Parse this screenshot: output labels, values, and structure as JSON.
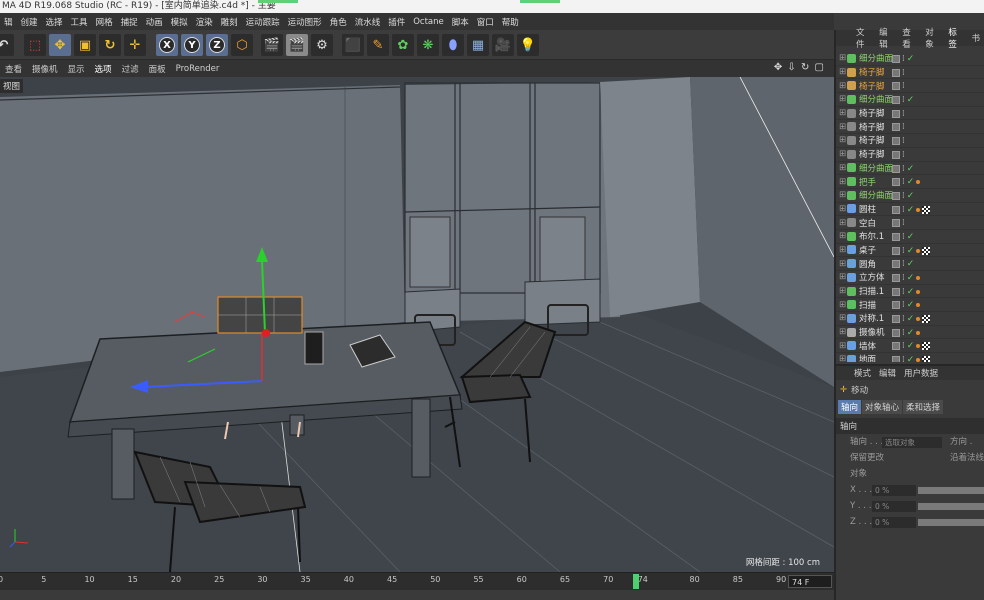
{
  "window": {
    "title": "MA 4D R19.068 Studio (RC - R19) - [室内简单追染.c4d *] - 主要"
  },
  "menubar": [
    "辑",
    "创建",
    "选择",
    "工具",
    "网格",
    "捕捉",
    "动画",
    "模拟",
    "渲染",
    "雕刻",
    "运动跟踪",
    "运动图形",
    "角色",
    "流水线",
    "插件",
    "Octane",
    "脚本",
    "窗口",
    "帮助"
  ],
  "toolbar": {
    "x_label": "X",
    "y_label": "Y",
    "z_label": "Z"
  },
  "viewport_menu": [
    "查看",
    "摄像机",
    "显示",
    "选项",
    "过滤",
    "面板",
    "ProRender"
  ],
  "viewport": {
    "label": "视图",
    "grid_distance": "网格间距 : 100 cm"
  },
  "timeline": {
    "ticks": [
      "0",
      "5",
      "10",
      "15",
      "20",
      "25",
      "30",
      "35",
      "40",
      "45",
      "50",
      "55",
      "60",
      "65",
      "70",
      "74",
      "80",
      "85",
      "90"
    ],
    "current_frame": "74",
    "frame_field": "74 F"
  },
  "object_manager": {
    "tabs": [
      "文件",
      "编辑",
      "查看",
      "对象",
      "标签",
      "书"
    ],
    "rows": [
      {
        "name": "细分曲面",
        "color": "green",
        "icon": "#5fbf5f",
        "tags": [
          "check"
        ]
      },
      {
        "name": "椅子脚",
        "color": "orange",
        "icon": "#d0a050",
        "tags": []
      },
      {
        "name": "椅子脚",
        "color": "orange",
        "icon": "#d0a050",
        "tags": []
      },
      {
        "name": "细分曲面",
        "color": "green",
        "icon": "#5fbf5f",
        "tags": [
          "check"
        ]
      },
      {
        "name": "椅子脚",
        "color": "white",
        "icon": "#888",
        "tags": []
      },
      {
        "name": "椅子脚",
        "color": "white",
        "icon": "#888",
        "tags": []
      },
      {
        "name": "椅子脚",
        "color": "white",
        "icon": "#888",
        "tags": []
      },
      {
        "name": "椅子脚",
        "color": "white",
        "icon": "#888",
        "tags": []
      },
      {
        "name": "细分曲面",
        "color": "green",
        "icon": "#5fbf5f",
        "tags": [
          "check"
        ]
      },
      {
        "name": "把手",
        "color": "green",
        "icon": "#5fbf5f",
        "tags": [
          "check",
          "dot"
        ]
      },
      {
        "name": "细分曲面",
        "color": "green",
        "icon": "#5fbf5f",
        "tags": [
          "check"
        ]
      },
      {
        "name": "圆柱",
        "color": "white",
        "icon": "#6aa0e0",
        "tags": [
          "check",
          "dot",
          "checker"
        ]
      },
      {
        "name": "空白",
        "color": "white",
        "icon": "#888",
        "tags": []
      },
      {
        "name": "布尔.1",
        "color": "white",
        "icon": "#5fbf5f",
        "tags": [
          "check"
        ]
      },
      {
        "name": "桌子",
        "color": "white",
        "icon": "#6aa0e0",
        "tags": [
          "check",
          "dot",
          "checker"
        ]
      },
      {
        "name": "圆角",
        "color": "white",
        "icon": "#6aa0e0",
        "tags": [
          "check"
        ]
      },
      {
        "name": "立方体",
        "color": "white",
        "icon": "#6aa0e0",
        "tags": [
          "check",
          "dot"
        ]
      },
      {
        "name": "扫描.1",
        "color": "white",
        "icon": "#5fbf5f",
        "tags": [
          "check",
          "dot"
        ]
      },
      {
        "name": "扫描",
        "color": "white",
        "icon": "#5fbf5f",
        "tags": [
          "check",
          "dot"
        ]
      },
      {
        "name": "对称.1",
        "color": "white",
        "icon": "#6aa0e0",
        "tags": [
          "check",
          "dot",
          "checker"
        ]
      },
      {
        "name": "摄像机",
        "color": "white",
        "icon": "#aaa",
        "tags": [
          "check",
          "dot"
        ]
      },
      {
        "name": "墙体",
        "color": "white",
        "icon": "#6aa0e0",
        "tags": [
          "check",
          "dot",
          "checker"
        ]
      },
      {
        "name": "地面",
        "color": "white",
        "icon": "#6aa0e0",
        "tags": [
          "check",
          "dot",
          "checker"
        ]
      }
    ]
  },
  "attributes": {
    "tabs": [
      "模式",
      "编辑",
      "用户数据"
    ],
    "tool_name": "移动",
    "subtabs": [
      "轴向",
      "对象轴心",
      "柔和选择"
    ],
    "section": "轴向",
    "axis_label": "轴向 . . .",
    "axis_value": "选取对象",
    "direction_label": "方向 .",
    "keep_changes": "保留更改",
    "along_normal": "沿着法线",
    "object_label": "对象",
    "x_label": "X . . .",
    "y_label": "Y . . .",
    "z_label": "Z . . .",
    "x_value": "0 %",
    "y_value": "0 %",
    "z_value": "0 %"
  }
}
